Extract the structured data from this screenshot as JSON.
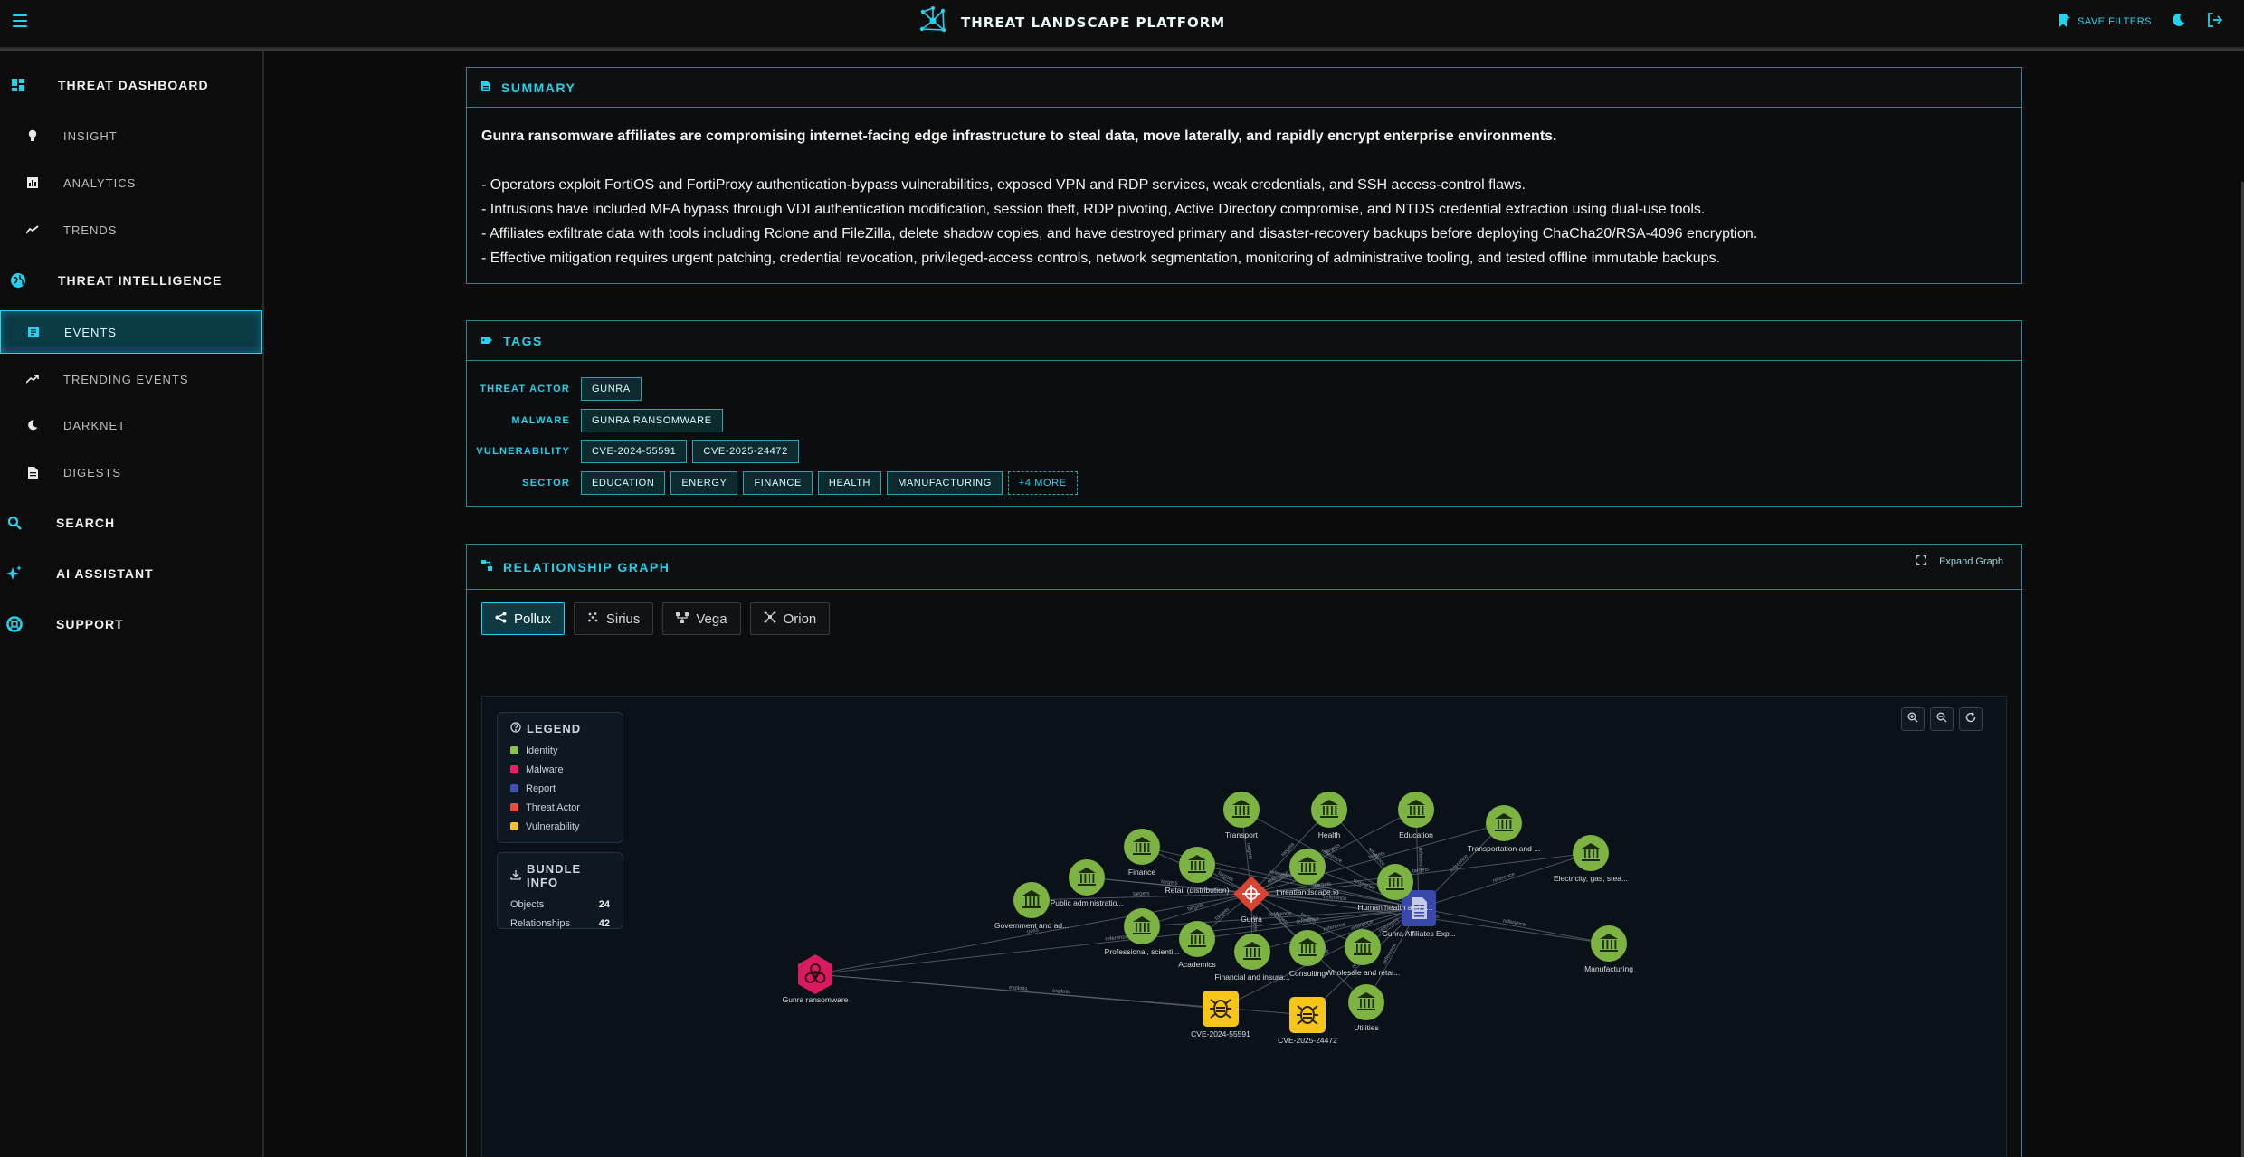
{
  "header": {
    "title": "THREAT LANDSCAPE PLATFORM",
    "save_filters": "SAVE FILTERS"
  },
  "sidebar": {
    "sections": [
      {
        "label": "THREAT DASHBOARD",
        "icon": "dashboard-icon"
      },
      {
        "label": "THREAT INTELLIGENCE",
        "icon": "globe-icon"
      },
      {
        "label": "SEARCH",
        "icon": "search-icon"
      },
      {
        "label": "AI ASSISTANT",
        "icon": "sparkles-icon"
      },
      {
        "label": "SUPPORT",
        "icon": "lifebuoy-icon"
      }
    ],
    "items": [
      {
        "label": "INSIGHT",
        "icon": "lightbulb-icon"
      },
      {
        "label": "ANALYTICS",
        "icon": "bar-chart-icon"
      },
      {
        "label": "TRENDS",
        "icon": "trend-line-icon"
      },
      {
        "label": "EVENTS",
        "icon": "document-icon"
      },
      {
        "label": "TRENDING EVENTS",
        "icon": "trending-up-icon"
      },
      {
        "label": "DARKNET",
        "icon": "moon-icon"
      },
      {
        "label": "DIGESTS",
        "icon": "file-icon"
      }
    ]
  },
  "summary": {
    "title": "SUMMARY",
    "lead": "Gunra ransomware affiliates are compromising internet-facing edge infrastructure to steal data, move laterally, and rapidly encrypt enterprise environments.",
    "bullets": [
      "- Operators exploit FortiOS and FortiProxy authentication-bypass vulnerabilities, exposed VPN and RDP services, weak credentials, and SSH access-control flaws.",
      "- Intrusions have included MFA bypass through VDI authentication modification, session theft, RDP pivoting, Active Directory compromise, and NTDS credential extraction using dual-use tools.",
      "- Affiliates exfiltrate data with tools including Rclone and FileZilla, delete shadow copies, and have destroyed primary and disaster-recovery backups before deploying ChaCha20/RSA-4096 encryption.",
      "- Effective mitigation requires urgent patching, credential revocation, privileged-access controls, network segmentation, monitoring of administrative tooling, and tested offline immutable backups."
    ]
  },
  "tags": {
    "title": "TAGS",
    "rows": [
      {
        "label": "THREAT ACTOR",
        "chips": [
          "GUNRA"
        ]
      },
      {
        "label": "MALWARE",
        "chips": [
          "GUNRA RANSOMWARE"
        ]
      },
      {
        "label": "VULNERABILITY",
        "chips": [
          "CVE-2024-55591",
          "CVE-2025-24472"
        ]
      },
      {
        "label": "SECTOR",
        "chips": [
          "EDUCATION",
          "ENERGY",
          "FINANCE",
          "HEALTH",
          "MANUFACTURING"
        ],
        "more": "+4 MORE"
      }
    ]
  },
  "graph": {
    "title": "RELATIONSHIP GRAPH",
    "expand": "Expand Graph",
    "tabs": [
      "Pollux",
      "Sirius",
      "Vega",
      "Orion"
    ],
    "legend_title": "LEGEND",
    "legend": [
      {
        "label": "Identity",
        "color": "#8bc34a"
      },
      {
        "label": "Malware",
        "color": "#e91e63"
      },
      {
        "label": "Report",
        "color": "#3f51b5"
      },
      {
        "label": "Threat Actor",
        "color": "#e74c3c"
      },
      {
        "label": "Vulnerability",
        "color": "#f5c518"
      }
    ],
    "bundle_title": "BUNDLE INFO",
    "bundle": [
      {
        "label": "Objects",
        "value": "24"
      },
      {
        "label": "Relationships",
        "value": "42"
      }
    ],
    "nodes": [
      {
        "id": "gunra",
        "label": "Gunra",
        "type": "actor"
      },
      {
        "id": "report",
        "label": "Gunra Affiliates Exp...",
        "type": "report"
      },
      {
        "id": "malware",
        "label": "Gunra ransomware",
        "type": "malware"
      },
      {
        "id": "cve1",
        "label": "CVE-2024-55591",
        "type": "vuln"
      },
      {
        "id": "cve2",
        "label": "CVE-2025-24472",
        "type": "vuln"
      },
      {
        "id": "transport",
        "label": "Transport",
        "type": "identity"
      },
      {
        "id": "health",
        "label": "Health",
        "type": "identity"
      },
      {
        "id": "education",
        "label": "Education",
        "type": "identity"
      },
      {
        "id": "transportation",
        "label": "Transportation and ...",
        "type": "identity"
      },
      {
        "id": "electricity",
        "label": "Electricity, gas, stea...",
        "type": "identity"
      },
      {
        "id": "finance",
        "label": "Finance",
        "type": "identity"
      },
      {
        "id": "retail",
        "label": "Retail (distribution)",
        "type": "identity"
      },
      {
        "id": "tlp",
        "label": "threatlandscape.io",
        "type": "identity"
      },
      {
        "id": "human",
        "label": "Human health and s...",
        "type": "identity"
      },
      {
        "id": "publicadmin",
        "label": "Public administratio...",
        "type": "identity"
      },
      {
        "id": "government",
        "label": "Government and ad...",
        "type": "identity"
      },
      {
        "id": "professional",
        "label": "Professional, scienti...",
        "type": "identity"
      },
      {
        "id": "academics",
        "label": "Academics",
        "type": "identity"
      },
      {
        "id": "financial",
        "label": "Financial and insura...",
        "type": "identity"
      },
      {
        "id": "consulting",
        "label": "Consulting",
        "type": "identity"
      },
      {
        "id": "wholesale",
        "label": "Wholesale and retai...",
        "type": "identity"
      },
      {
        "id": "manufacturing",
        "label": "Manufacturing",
        "type": "identity"
      },
      {
        "id": "utilities",
        "label": "Utilities",
        "type": "identity"
      }
    ],
    "edges": [
      {
        "s": "gunra",
        "t": "transport",
        "label": "targets"
      },
      {
        "s": "gunra",
        "t": "health",
        "label": "targets"
      },
      {
        "s": "gunra",
        "t": "education",
        "label": "targets"
      },
      {
        "s": "gunra",
        "t": "finance",
        "label": "targets"
      },
      {
        "s": "gunra",
        "t": "retail",
        "label": "targets"
      },
      {
        "s": "gunra",
        "t": "publicadmin",
        "label": "targets"
      },
      {
        "s": "gunra",
        "t": "government",
        "label": "targets"
      },
      {
        "s": "gunra",
        "t": "professional",
        "label": "targets"
      },
      {
        "s": "gunra",
        "t": "academics",
        "label": "targets"
      },
      {
        "s": "gunra",
        "t": "financial",
        "label": "targets"
      },
      {
        "s": "gunra",
        "t": "consulting",
        "label": "targets"
      },
      {
        "s": "gunra",
        "t": "wholesale",
        "label": "targets"
      },
      {
        "s": "gunra",
        "t": "human",
        "label": "targets"
      },
      {
        "s": "gunra",
        "t": "transportation",
        "label": "targets"
      },
      {
        "s": "gunra",
        "t": "tlp",
        "label": "reference"
      },
      {
        "s": "gunra",
        "t": "malware",
        "label": "uses"
      },
      {
        "s": "report",
        "t": "gunra",
        "label": "reference"
      },
      {
        "s": "report",
        "t": "transport",
        "label": "reference"
      },
      {
        "s": "report",
        "t": "health",
        "label": "reference"
      },
      {
        "s": "report",
        "t": "education",
        "label": "reference"
      },
      {
        "s": "report",
        "t": "transportation",
        "label": "reference"
      },
      {
        "s": "report",
        "t": "electricity",
        "label": "reference"
      },
      {
        "s": "report",
        "t": "finance",
        "label": "reference"
      },
      {
        "s": "report",
        "t": "retail",
        "label": "reference"
      },
      {
        "s": "report",
        "t": "tlp",
        "label": "reference"
      },
      {
        "s": "report",
        "t": "human",
        "label": "reference"
      },
      {
        "s": "report",
        "t": "publicadmin",
        "label": "reference"
      },
      {
        "s": "report",
        "t": "professional",
        "label": "reference"
      },
      {
        "s": "report",
        "t": "academics",
        "label": "reference"
      },
      {
        "s": "report",
        "t": "financial",
        "label": "reference"
      },
      {
        "s": "report",
        "t": "consulting",
        "label": "reference"
      },
      {
        "s": "report",
        "t": "wholesale",
        "label": "reference"
      },
      {
        "s": "report",
        "t": "manufacturing",
        "label": "reference"
      },
      {
        "s": "report",
        "t": "utilities",
        "label": "reference"
      },
      {
        "s": "report",
        "t": "malware",
        "label": "reference"
      },
      {
        "s": "report",
        "t": "cve1",
        "label": "reference"
      },
      {
        "s": "report",
        "t": "cve2",
        "label": "reference"
      },
      {
        "s": "malware",
        "t": "cve1",
        "label": "exploits"
      },
      {
        "s": "malware",
        "t": "cve2",
        "label": "exploits"
      },
      {
        "s": "gunra",
        "t": "electricity",
        "label": "targets"
      },
      {
        "s": "gunra",
        "t": "manufacturing",
        "label": "targets"
      },
      {
        "s": "gunra",
        "t": "utilities",
        "label": "targets"
      }
    ]
  }
}
